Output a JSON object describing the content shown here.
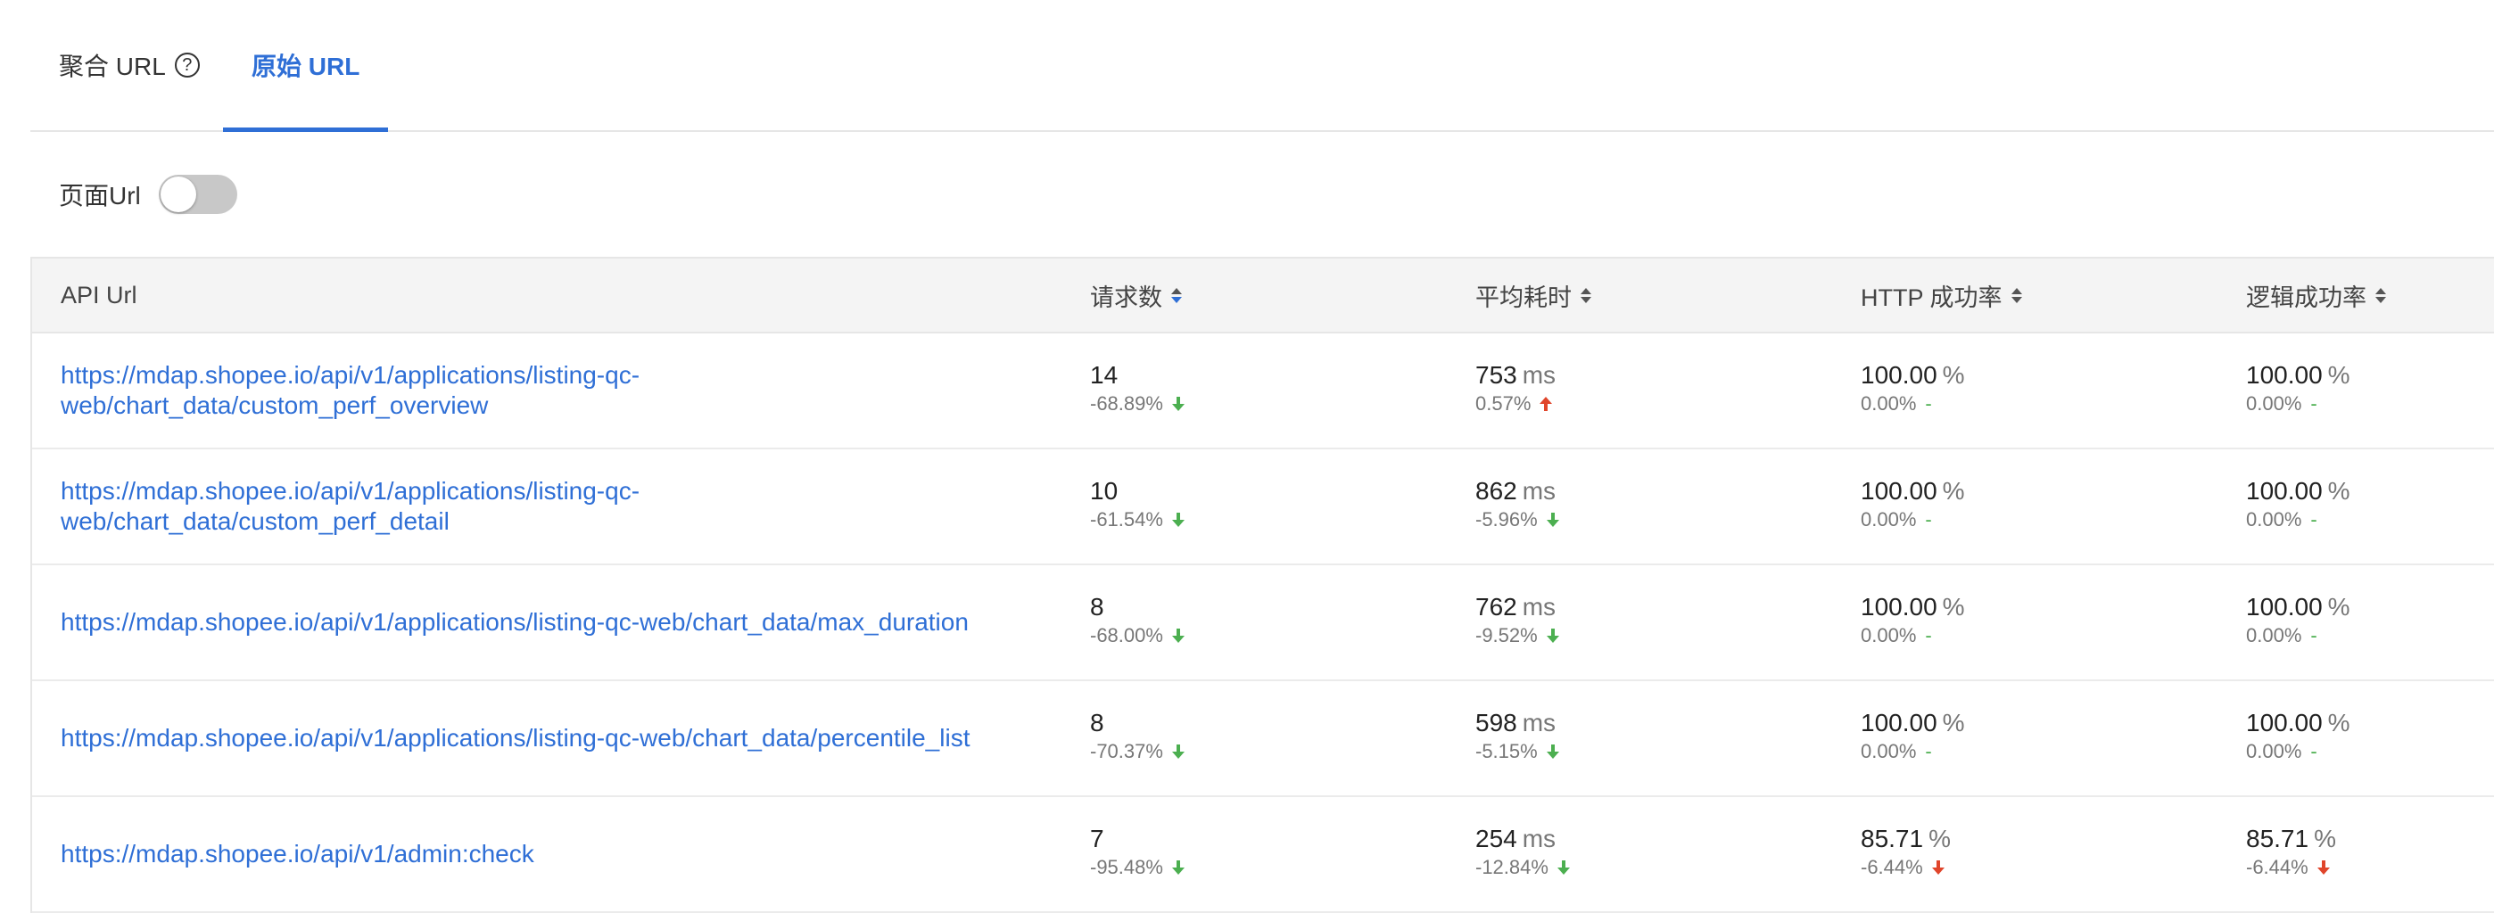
{
  "tabs": [
    {
      "label": "聚合 URL",
      "help": "?"
    },
    {
      "label": "原始 URL"
    }
  ],
  "toggle": {
    "label": "页面Url",
    "on": false
  },
  "table": {
    "headers": [
      "API Url",
      "请求数",
      "平均耗时",
      "HTTP 成功率",
      "逻辑成功率"
    ],
    "rows": [
      {
        "url_line1": "https://mdap.shopee.io/api/v1/applications/listing-qc-",
        "url_line2": "web/chart_data/custom_perf_overview",
        "count": "14",
        "count_change": "-68.89%",
        "count_trend": "down",
        "avg": "753",
        "avg_unit": "ms",
        "avg_change": "0.57%",
        "avg_trend": "up",
        "http": "100.00",
        "http_unit": "%",
        "http_change": "0.00%",
        "http_trend": "-",
        "logic": "100.00",
        "logic_unit": "%",
        "logic_change": "0.00%",
        "logic_trend": "-"
      },
      {
        "url_line1": "https://mdap.shopee.io/api/v1/applications/listing-qc-",
        "url_line2": "web/chart_data/custom_perf_detail",
        "count": "10",
        "count_change": "-61.54%",
        "count_trend": "down",
        "avg": "862",
        "avg_unit": "ms",
        "avg_change": "-5.96%",
        "avg_trend": "down",
        "http": "100.00",
        "http_unit": "%",
        "http_change": "0.00%",
        "http_trend": "-",
        "logic": "100.00",
        "logic_unit": "%",
        "logic_change": "0.00%",
        "logic_trend": "-"
      },
      {
        "url_line1": "https://mdap.shopee.io/api/v1/applications/listing-qc-web/chart_data/max_duration",
        "url_line2": "",
        "count": "8",
        "count_change": "-68.00%",
        "count_trend": "down",
        "avg": "762",
        "avg_unit": "ms",
        "avg_change": "-9.52%",
        "avg_trend": "down",
        "http": "100.00",
        "http_unit": "%",
        "http_change": "0.00%",
        "http_trend": "-",
        "logic": "100.00",
        "logic_unit": "%",
        "logic_change": "0.00%",
        "logic_trend": "-"
      },
      {
        "url_line1": "https://mdap.shopee.io/api/v1/applications/listing-qc-web/chart_data/percentile_list",
        "url_line2": "",
        "count": "8",
        "count_change": "-70.37%",
        "count_trend": "down",
        "avg": "598",
        "avg_unit": "ms",
        "avg_change": "-5.15%",
        "avg_trend": "down",
        "http": "100.00",
        "http_unit": "%",
        "http_change": "0.00%",
        "http_trend": "-",
        "logic": "100.00",
        "logic_unit": "%",
        "logic_change": "0.00%",
        "logic_trend": "-"
      },
      {
        "url_line1": "https://mdap.shopee.io/api/v1/admin:check",
        "url_line2": "",
        "count": "7",
        "count_change": "-95.48%",
        "count_trend": "down",
        "avg": "254",
        "avg_unit": "ms",
        "avg_change": "-12.84%",
        "avg_trend": "down",
        "http": "85.71",
        "http_unit": "%",
        "http_change": "-6.44%",
        "http_trend": "bad-down",
        "logic": "85.71",
        "logic_unit": "%",
        "logic_change": "-6.44%",
        "logic_trend": "bad-down"
      }
    ]
  },
  "colors": {
    "accent": "#2f6fd6",
    "good": "#4caf50",
    "bad": "#e0452b"
  }
}
